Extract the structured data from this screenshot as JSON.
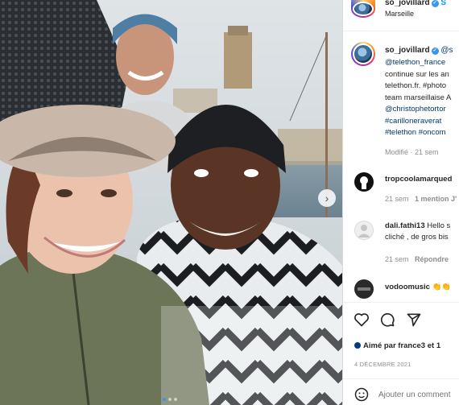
{
  "post": {
    "username": "so_jovillard",
    "location": "Marseille",
    "header_more": "S"
  },
  "caption": {
    "username": "so_jovillard",
    "mention_start": "@s",
    "lines": [
      "@telethon_france ",
      "continue sur les an",
      "telethon.fr. #photo",
      "team marseillaise A",
      "@christophetortor",
      "#carilloneraverat ",
      "#telethon #oncom"
    ],
    "meta": "Modifié · 21 sem"
  },
  "comments": [
    {
      "username": "tropcoolamarqued",
      "text": "",
      "time": "21 sem",
      "likes": "1 mention J'",
      "reply": ""
    },
    {
      "username": "dali.fathi13",
      "text_1": "Hello s",
      "text_2": "cliché , de gros bis",
      "time": "21 sem",
      "reply": "Répondre"
    },
    {
      "username": "vodoomusic",
      "text": "👏👏"
    }
  ],
  "actions": {
    "liked_by": "Aimé par france3 et 1",
    "date": "4 DÉCEMBRE 2021",
    "comment_placeholder": "Ajouter un comment"
  },
  "icons": {
    "like": "heart-icon",
    "comment": "comment-bubble-icon",
    "share": "paper-plane-icon",
    "add_comment": "smiley-icon",
    "next": "chevron-right-icon"
  },
  "carousel": {
    "slides": 3,
    "current": 1
  }
}
